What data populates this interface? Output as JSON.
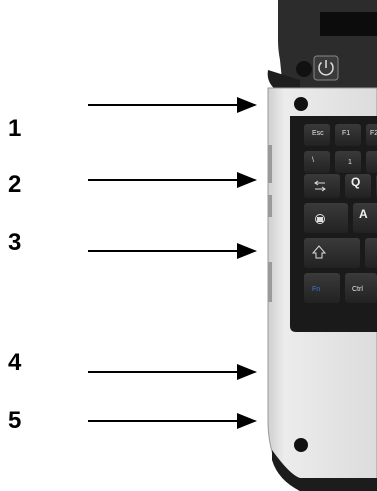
{
  "callouts": [
    {
      "label": "1"
    },
    {
      "label": "2"
    },
    {
      "label": "3"
    },
    {
      "label": "4"
    },
    {
      "label": "5"
    }
  ],
  "keys": {
    "esc": "Esc",
    "f1": "F1",
    "f2": "F2",
    "one": "1",
    "q": "Q",
    "a": "A",
    "ctrl": "Ctrl",
    "fn": "Fn"
  },
  "icons": [
    "power-icon"
  ],
  "colors": {
    "body_light": "#e2e2e2",
    "body_dark": "#2a2a2a",
    "keyboard_bg": "#1a1a1a",
    "key": "#2e2e2e",
    "fn_key_text": "#3a7ad8"
  }
}
